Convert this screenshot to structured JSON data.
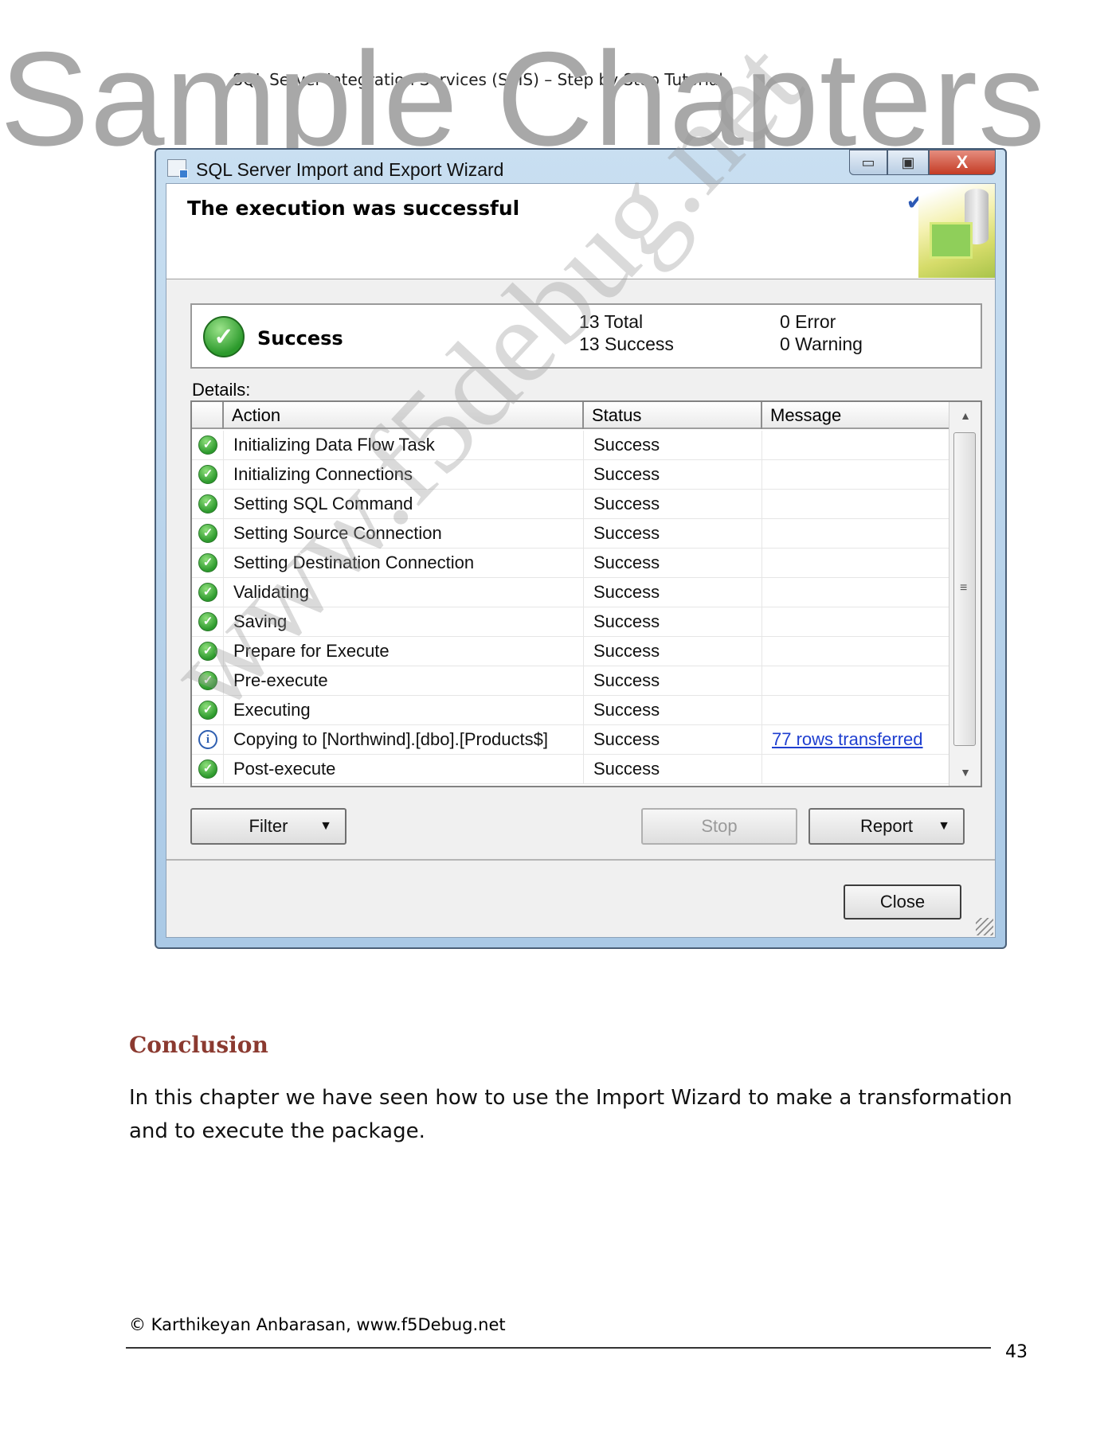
{
  "watermark": {
    "top_text": "Sample Chapters",
    "diagonal_text": "www.f5debug.net"
  },
  "running_header": "SQL Server Integration Services (SSIS) – Step by Step Tutorial",
  "window": {
    "title": "SQL Server Import and Export Wizard",
    "buttons": {
      "minimize": "▭",
      "maximize": "▣",
      "close": "X"
    },
    "header_title": "The execution was successful",
    "summary": {
      "status": "Success",
      "total": "13  Total",
      "success": "13  Success",
      "error": "0  Error",
      "warning": "0  Warning"
    },
    "details_label": "Details:",
    "columns": {
      "action": "Action",
      "status": "Status",
      "message": "Message"
    },
    "rows": [
      {
        "icon": "success-icon",
        "action": "Initializing Data Flow Task",
        "status": "Success",
        "message": ""
      },
      {
        "icon": "success-icon",
        "action": "Initializing Connections",
        "status": "Success",
        "message": ""
      },
      {
        "icon": "success-icon",
        "action": "Setting SQL Command",
        "status": "Success",
        "message": ""
      },
      {
        "icon": "success-icon",
        "action": "Setting Source Connection",
        "status": "Success",
        "message": ""
      },
      {
        "icon": "success-icon",
        "action": "Setting Destination Connection",
        "status": "Success",
        "message": ""
      },
      {
        "icon": "success-icon",
        "action": "Validating",
        "status": "Success",
        "message": ""
      },
      {
        "icon": "success-icon",
        "action": "Saving",
        "status": "Success",
        "message": ""
      },
      {
        "icon": "success-icon",
        "action": "Prepare for Execute",
        "status": "Success",
        "message": ""
      },
      {
        "icon": "success-icon",
        "action": "Pre-execute",
        "status": "Success",
        "message": ""
      },
      {
        "icon": "success-icon",
        "action": "Executing",
        "status": "Success",
        "message": ""
      },
      {
        "icon": "info-icon",
        "action": "Copying to [Northwind].[dbo].[Products$]",
        "status": "Success",
        "message": "77 rows transferred"
      },
      {
        "icon": "success-icon",
        "action": "Post-execute",
        "status": "Success",
        "message": ""
      }
    ],
    "buttons_row": {
      "filter": "Filter",
      "stop": "Stop",
      "report": "Report",
      "close": "Close"
    },
    "colors": {
      "success_green": "#2d9a2d",
      "link_blue": "#1f3fd0",
      "close_red": "#c43b24"
    }
  },
  "conclusion": {
    "heading": "Conclusion",
    "body": "In this chapter we have seen how to use the Import Wizard to make a transformation and to execute the package."
  },
  "footer": {
    "copyright": "© Karthikeyan Anbarasan, www.f5Debug.net",
    "page_number": "43"
  }
}
